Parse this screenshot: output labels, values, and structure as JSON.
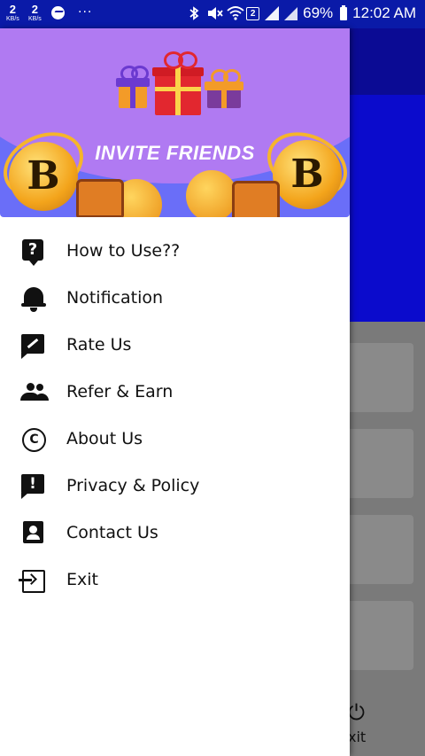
{
  "status_bar": {
    "speed1_value": "2",
    "speed1_unit": "KB/s",
    "speed2_value": "2",
    "speed2_unit": "KB/s",
    "more_dots": "···",
    "sim_badge": "2",
    "battery": "69%",
    "time": "12:02 AM"
  },
  "drawer": {
    "banner_title": "INVITE FRIENDS",
    "coin_symbol": "B",
    "items": [
      {
        "label": "How to Use??",
        "icon": "help-icon"
      },
      {
        "label": "Notification",
        "icon": "bell-icon"
      },
      {
        "label": "Rate Us",
        "icon": "rate-review-icon"
      },
      {
        "label": "Refer & Earn",
        "icon": "group-icon"
      },
      {
        "label": "About Us",
        "icon": "copyright-icon"
      },
      {
        "label": "Privacy & Policy",
        "icon": "feedback-icon"
      },
      {
        "label": "Contact Us",
        "icon": "contact-card-icon"
      },
      {
        "label": "Exit",
        "icon": "exit-icon"
      }
    ]
  },
  "background": {
    "exit_label": "xit"
  },
  "colors": {
    "status_bar": "#0a1aa8",
    "header_dark": "#0b0b94",
    "header_blue": "#0b0bcc",
    "banner_purple": "#6a6ef8",
    "banner_arc": "#b07af2",
    "coin_gold": "#f3a41b"
  }
}
